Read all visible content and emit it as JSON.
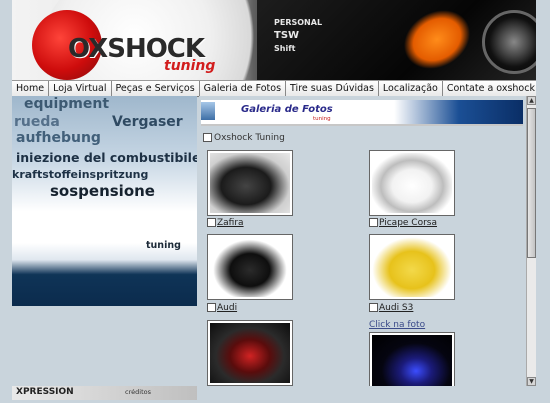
{
  "header": {
    "logo_main": "OXSHOCK",
    "logo_sub": "tuning",
    "stickers": [
      "PERSONAL",
      "TSW",
      "Shift"
    ]
  },
  "nav": {
    "items": [
      {
        "label": "Home"
      },
      {
        "label": "Loja Virtual"
      },
      {
        "label": "Peças e Serviços"
      },
      {
        "label": "Galeria de Fotos"
      },
      {
        "label": "Tire suas Dúvidas"
      },
      {
        "label": "Localização"
      },
      {
        "label": "Contate a oxshock"
      }
    ]
  },
  "left_panel": {
    "words": [
      "equipment",
      "rueda",
      "Vergaser",
      "aufhebung",
      "iniezione del combustibile",
      "kraftstoffeinspritzung",
      "sospensione",
      "tuning"
    ]
  },
  "footer": {
    "brand": "XPRESSION",
    "credits": "créditos"
  },
  "gallery": {
    "title": "Galeria de Fotos",
    "subtitle": "tuning",
    "breadcrumb": "Oxshock Tuning",
    "items": [
      {
        "caption": "Zafira",
        "image": "car-zafira"
      },
      {
        "caption": "Picape Corsa",
        "image": "car-corsa"
      },
      {
        "caption": "Audi",
        "image": "car-audi"
      },
      {
        "caption": "Audi S3",
        "image": "car-audi-s3"
      },
      {
        "caption": "",
        "image": "car-interior"
      },
      {
        "caption": "Click na foto",
        "image": "car-night"
      }
    ]
  },
  "colors": {
    "accent_red": "#d21d1d",
    "gallery_bar_blue": "#1b4f95",
    "page_bg": "#c9d4dc"
  }
}
